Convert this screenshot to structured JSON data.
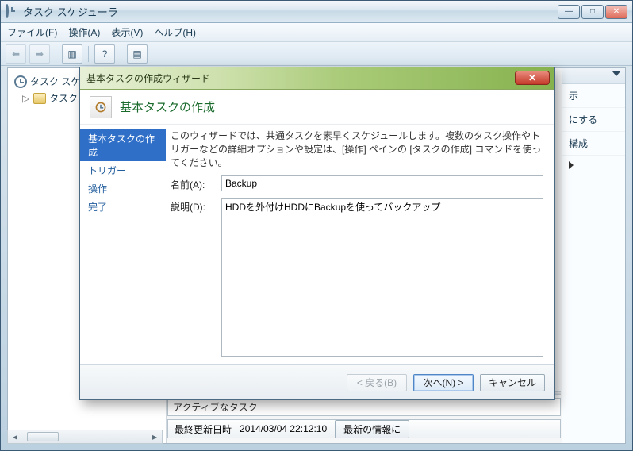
{
  "window": {
    "title": "タスク スケジューラ"
  },
  "menubar": {
    "file": "ファイル(F)",
    "action": "操作(A)",
    "view": "表示(V)",
    "help": "ヘルプ(H)"
  },
  "tree": {
    "root_label": "タスク スケ",
    "child_label": "タスク"
  },
  "right_strip": {
    "item1": "示",
    "item2": "にする",
    "item3": "構成"
  },
  "status": {
    "pseudo_row": "アクティブなタスク",
    "last_update_label": "最終更新日時",
    "last_update_time": "2014/03/04 22:12:10",
    "refresh_btn": "最新の情報に"
  },
  "dialog": {
    "title": "基本タスクの作成ウィザード",
    "header": "基本タスクの作成",
    "steps": {
      "s1": "基本タスクの作成",
      "s2": "トリガー",
      "s3": "操作",
      "s4": "完了"
    },
    "form": {
      "intro": "このウィザードでは、共通タスクを素早くスケジュールします。複数のタスク操作やトリガーなどの詳細オプションや設定は、[操作] ペインの [タスクの作成] コマンドを使ってください。",
      "name_label": "名前(A):",
      "name_value": "Backup",
      "desc_label": "説明(D):",
      "desc_value": "HDDを外付けHDDにBackupを使ってバックアップ"
    },
    "footer": {
      "back": "< 戻る(B)",
      "next": "次へ(N) >",
      "cancel": "キャンセル"
    }
  }
}
